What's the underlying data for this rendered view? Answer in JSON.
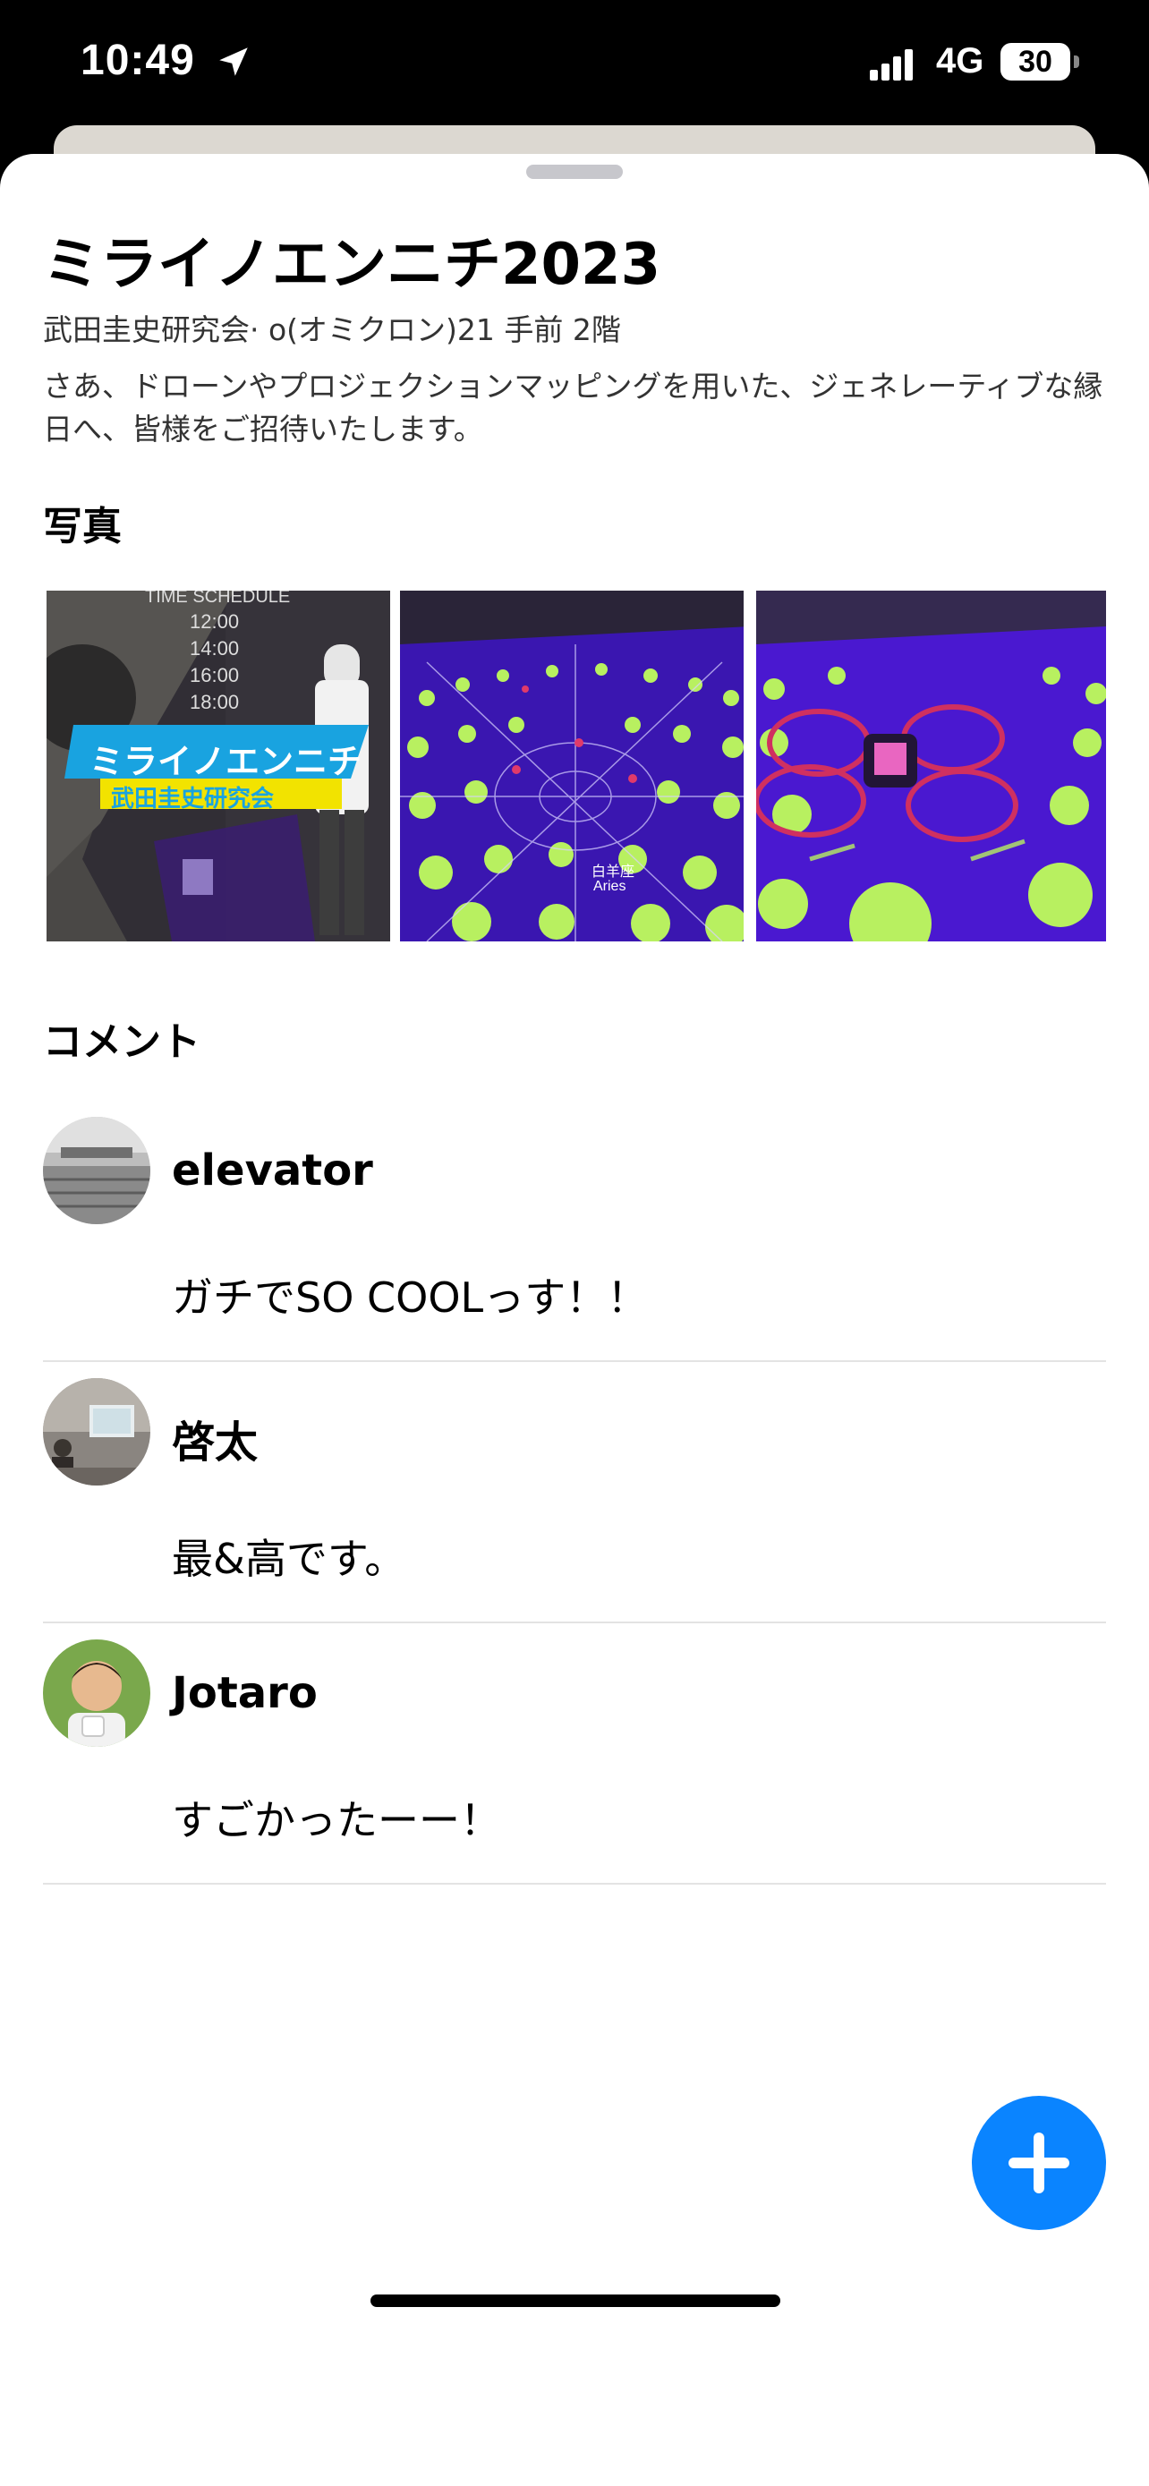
{
  "status_bar": {
    "time": "10:49",
    "network": "4G",
    "battery": "30",
    "icons": [
      "location-arrow-icon",
      "cellular-signal-icon",
      "battery-icon"
    ]
  },
  "event": {
    "title": "ミライノエンニチ2023",
    "location": "武田圭史研究会· o(オミクロン)21 手前 2階",
    "description": "さあ、ドローンやプロジェクションマッピングを用いた、ジェネレーティブな縁日へ、皆様をご招待いたします。"
  },
  "photos_section": {
    "heading": "写真",
    "photos": [
      {
        "overlay_title": "ミライノエンニチ",
        "overlay_subtitle": "武田圭史研究会",
        "schedule_heading": "TIME SCHEDULE",
        "schedule": [
          "12:00",
          "14:00",
          "16:00",
          "18:00"
        ]
      },
      {
        "caption": "白羊座",
        "caption_latin": "Aries"
      },
      {}
    ]
  },
  "comments_section": {
    "heading": "コメント",
    "comments": [
      {
        "name": "elevator",
        "text": "ガチでSO COOLっす！！"
      },
      {
        "name": "啓太",
        "text": "最&高です。"
      },
      {
        "name": "Jotaro",
        "text": "すごかったーー！"
      }
    ]
  },
  "colors": {
    "accent": "#0a84ff",
    "divider": "#e3e3e3",
    "sheet_background": "#ffffff",
    "status_bar_background": "#000000"
  },
  "fab": {
    "icon": "plus-icon"
  }
}
